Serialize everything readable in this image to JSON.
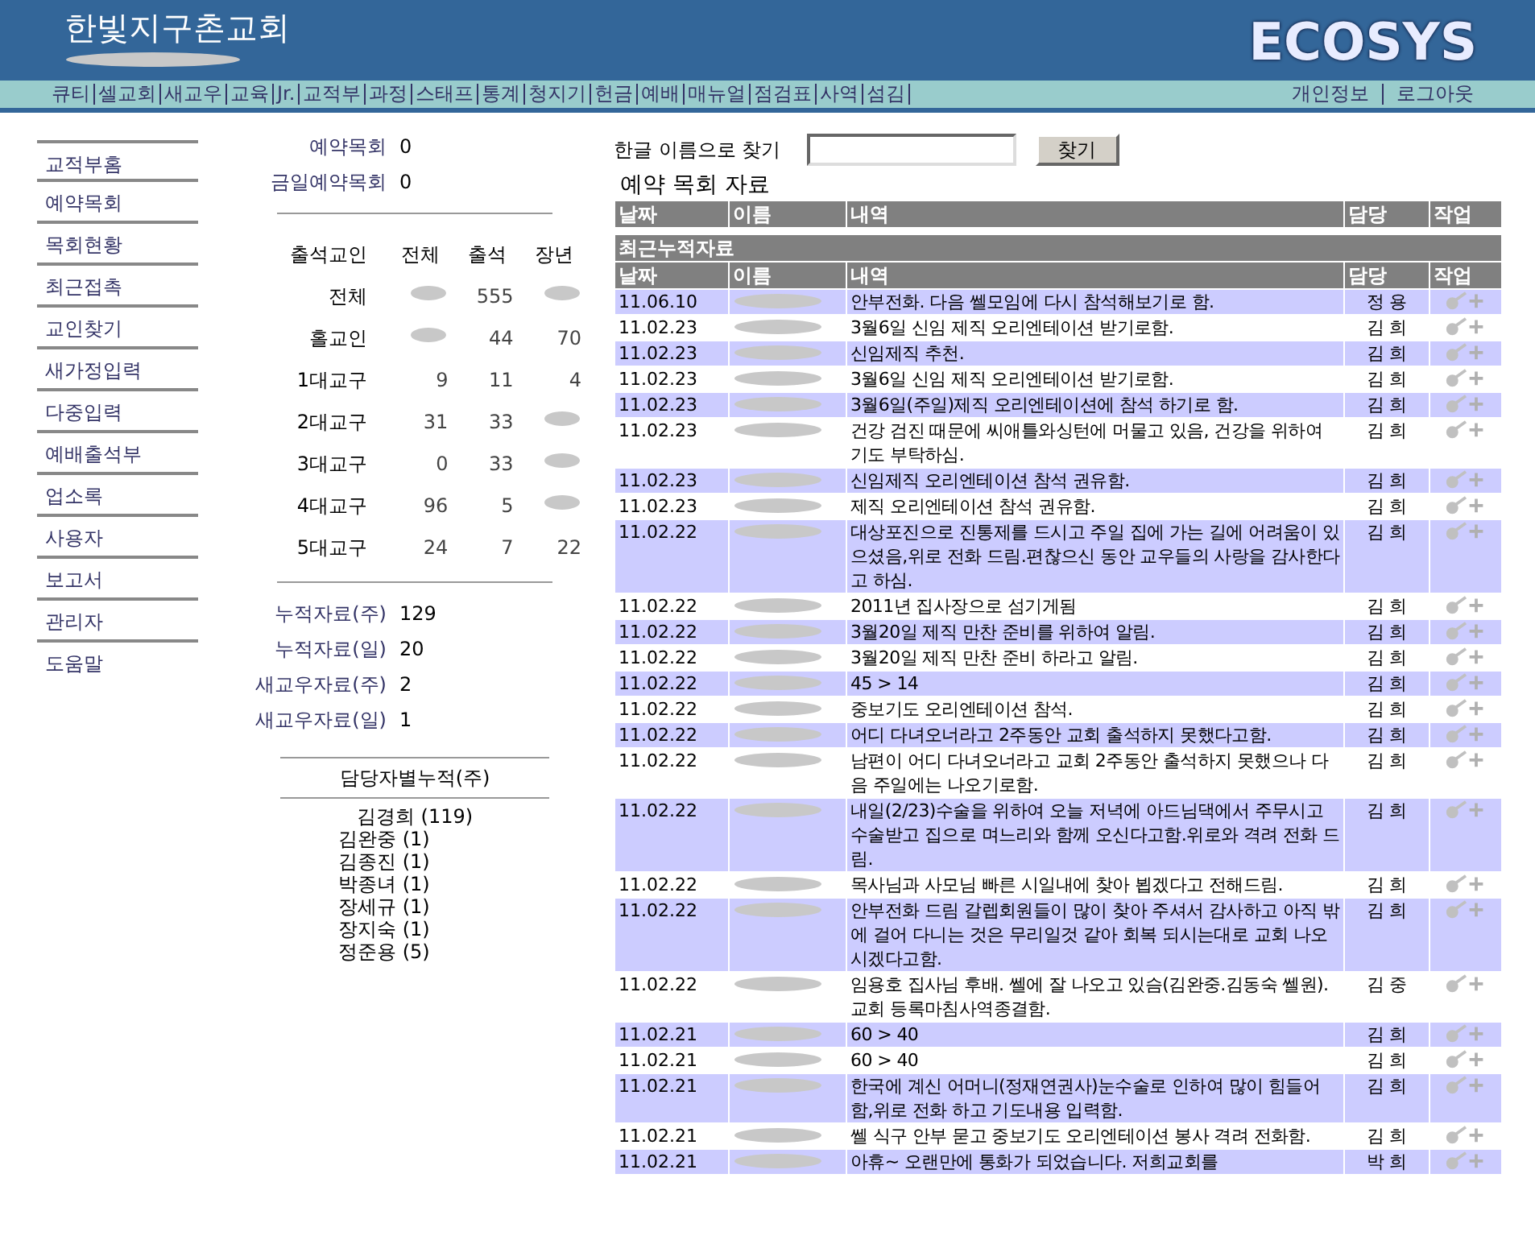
{
  "header": {
    "title": "한빛지구촌교회",
    "logo": "ECOSYS"
  },
  "menu": {
    "items": [
      "큐티",
      "셀교회",
      "새교우",
      "교육",
      "Jr.",
      "교적부",
      "과정",
      "스태프",
      "통계",
      "청지기",
      "헌금",
      "예배",
      "매뉴얼",
      "점검표",
      "사역",
      "섬김"
    ],
    "account": [
      "개인정보",
      "로그아웃"
    ]
  },
  "sidebar": {
    "items": [
      "교적부홈",
      "예약목회",
      "목회현황",
      "최근접촉",
      "교인찾기",
      "새가정입력",
      "다중입력",
      "예배출석부",
      "업소록",
      "사용자",
      "보고서",
      "관리자",
      "도움말"
    ]
  },
  "summary": {
    "reservations": [
      {
        "label": "예약목회",
        "value": "0"
      },
      {
        "label": "금일예약목회",
        "value": "0"
      }
    ],
    "attendance": {
      "columns": [
        "출석교인",
        "전체",
        "출석",
        "장년"
      ],
      "rows": [
        {
          "label": "전체",
          "attended": "555"
        },
        {
          "label": "홀교인",
          "attended": "44",
          "adult": "70"
        },
        {
          "label": "1대교구",
          "total": "9",
          "attended": "11",
          "adult": "4"
        },
        {
          "label": "2대교구",
          "total": "31",
          "attended": "33"
        },
        {
          "label": "3대교구",
          "total": "0",
          "attended": "33"
        },
        {
          "label": "4대교구",
          "total": "96",
          "attended": "5"
        },
        {
          "label": "5대교구",
          "total": "24",
          "attended": "7",
          "adult": "22"
        }
      ]
    },
    "cumulative": [
      {
        "label": "누적자료(주)",
        "value": "129"
      },
      {
        "label": "누적자료(일)",
        "value": "20"
      },
      {
        "label": "새교우자료(주)",
        "value": "2"
      },
      {
        "label": "새교우자료(일)",
        "value": "1"
      }
    ],
    "by_manager_title": "담당자별누적(주)",
    "by_manager": [
      "김경희 (119)",
      "김완중 (1)",
      "김종진 (1)",
      "박종녀 (1)",
      "장세규 (1)",
      "장지숙 (1)",
      "정준용 (5)"
    ]
  },
  "search": {
    "label": "한글 이름으로 찾기",
    "button": "찾기"
  },
  "reserved": {
    "title": "예약 목회 자료",
    "columns": [
      "날짜",
      "이름",
      "내역",
      "담당",
      "작업"
    ]
  },
  "recent": {
    "title": "최근누적자료",
    "columns": [
      "날짜",
      "이름",
      "내역",
      "담당",
      "작업"
    ],
    "rows": [
      {
        "date": "11.06.10",
        "content": "안부전화. 다음 쎌모임에 다시 참석해보기로 함.",
        "manager": "정 용"
      },
      {
        "date": "11.02.23",
        "content": "3월6일 신임 제직 오리엔테이션 받기로함.",
        "manager": "김 희"
      },
      {
        "date": "11.02.23",
        "content": "신임제직 추천.",
        "manager": "김 희"
      },
      {
        "date": "11.02.23",
        "content": "3월6일 신임 제직 오리엔테이션 받기로함.",
        "manager": "김 희"
      },
      {
        "date": "11.02.23",
        "content": "3월6일(주일)제직 오리엔테이션에 참석 하기로 함.",
        "manager": "김 희"
      },
      {
        "date": "11.02.23",
        "content": "건강 검진 때문에 씨애틀와싱턴에 머물고 있음, 건강을 위하여 기도 부탁하심.",
        "manager": "김 희"
      },
      {
        "date": "11.02.23",
        "content": "신임제직 오리엔테이션 참석 권유함.",
        "manager": "김 희"
      },
      {
        "date": "11.02.23",
        "content": "제직 오리엔테이션 참석 권유함.",
        "manager": "김 희"
      },
      {
        "date": "11.02.22",
        "content": "대상포진으로 진통제를 드시고 주일 집에 가는 길에 어려움이 있으셨음,위로 전화 드림.편찮으신 동안 교우들의 사랑을 감사한다고 하심.",
        "manager": "김 희"
      },
      {
        "date": "11.02.22",
        "content": "2011년 집사장으로 섬기게됨",
        "manager": "김 희"
      },
      {
        "date": "11.02.22",
        "content": "3월20일 제직 만찬 준비를 위하여 알림.",
        "manager": "김 희"
      },
      {
        "date": "11.02.22",
        "content": "3월20일 제직 만찬 준비 하라고 알림.",
        "manager": "김 희"
      },
      {
        "date": "11.02.22",
        "content": "45 > 14",
        "manager": "김 희"
      },
      {
        "date": "11.02.22",
        "content": "중보기도 오리엔테이션 참석.",
        "manager": "김 희"
      },
      {
        "date": "11.02.22",
        "content": "어디 다녀오너라고 2주동안 교회 출석하지 못했다고함.",
        "manager": "김 희"
      },
      {
        "date": "11.02.22",
        "content": "남편이 어디 다녀오너라고 교회 2주동안 출석하지 못했으나 다음 주일에는 나오기로함.",
        "manager": "김 희"
      },
      {
        "date": "11.02.22",
        "content": "내일(2/23)수술을 위하여 오늘 저녁에 아드님댁에서 주무시고 수술받고 집으로 며느리와 함께 오신다고함.위로와 격려 전화 드림.",
        "manager": "김 희"
      },
      {
        "date": "11.02.22",
        "content": "목사님과 사모님 빠른 시일내에 찾아 뵙겠다고 전해드림.",
        "manager": "김 희"
      },
      {
        "date": "11.02.22",
        "content": "안부전화 드림 갈렙회원들이 많이 찾아 주셔서 감사하고 아직 밖에 걸어 다니는 것은 무리일것 같아 회복 되시는대로 교회 나오시겠다고함.",
        "manager": "김 희"
      },
      {
        "date": "11.02.22",
        "content": "임용호 집사님 후배. 쎌에 잘 나오고 있슴(김완중.김동숙 쎌원).교회 등록마침사역종결함.",
        "manager": "김 중"
      },
      {
        "date": "11.02.21",
        "content": "60 > 40",
        "manager": "김 희"
      },
      {
        "date": "11.02.21",
        "content": "60 > 40",
        "manager": "김 희"
      },
      {
        "date": "11.02.21",
        "content": "한국에 계신 어머니(정재연권사)눈수술로 인하여 많이 힘들어함,위로 전화 하고 기도내용 입력함.",
        "manager": "김 희"
      },
      {
        "date": "11.02.21",
        "content": "쎌 식구 안부 묻고 중보기도 오리엔테이션 봉사 격려 전화함.",
        "manager": "김 희"
      },
      {
        "date": "11.02.21",
        "content": "아휴~ 오랜만에 통화가 되었습니다. 저희교회를",
        "manager": "박 희"
      }
    ]
  }
}
